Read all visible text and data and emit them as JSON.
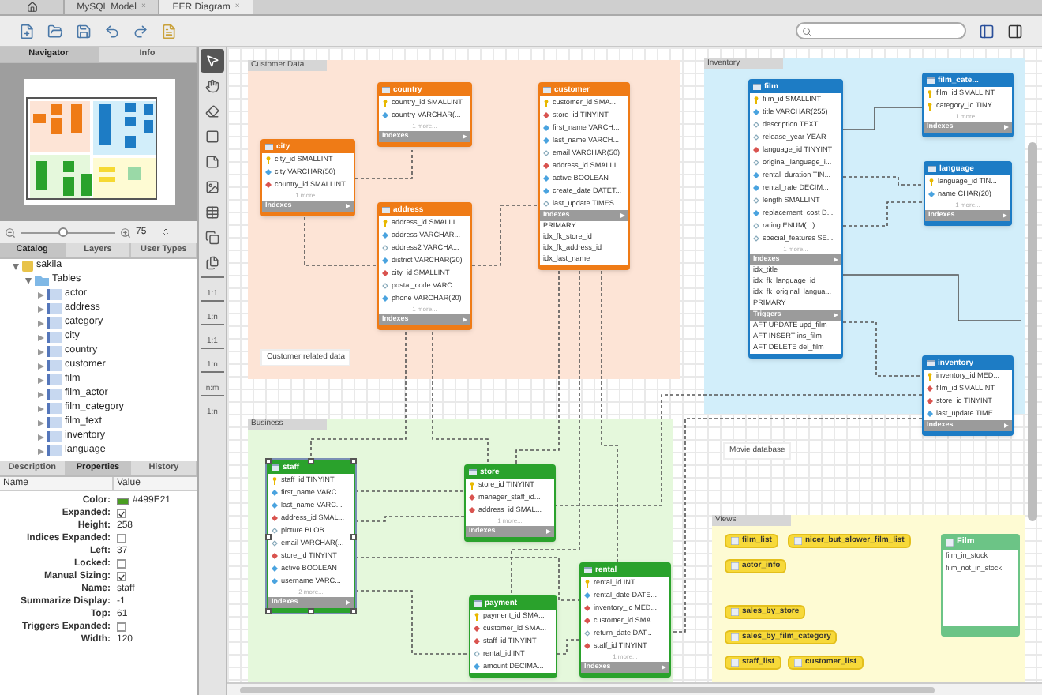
{
  "tabs": [
    {
      "label": "MySQL Model",
      "close": "×",
      "selected": false
    },
    {
      "label": "EER Diagram",
      "close": "×",
      "selected": true
    }
  ],
  "sidebar": {
    "top_tabs": [
      {
        "label": "Navigator",
        "selected": true
      },
      {
        "label": "Info",
        "selected": false
      }
    ],
    "zoom": {
      "level": 0.45,
      "value": "75"
    },
    "catalog_tabs": [
      {
        "label": "Catalog",
        "selected": true
      },
      {
        "label": "Layers",
        "selected": false
      },
      {
        "label": "User Types",
        "selected": false
      }
    ],
    "tree": [
      {
        "label": "sakila",
        "kind": "schema",
        "expanded": true,
        "children": [
          {
            "label": "Tables",
            "kind": "folder",
            "expanded": true,
            "children": [
              {
                "label": "actor",
                "kind": "table",
                "expanded": false
              },
              {
                "label": "address",
                "kind": "table",
                "expanded": false
              },
              {
                "label": "category",
                "kind": "table",
                "expanded": false
              },
              {
                "label": "city",
                "kind": "table",
                "expanded": false
              },
              {
                "label": "country",
                "kind": "table",
                "expanded": false
              },
              {
                "label": "customer",
                "kind": "table",
                "expanded": false
              },
              {
                "label": "film",
                "kind": "table",
                "expanded": false
              },
              {
                "label": "film_actor",
                "kind": "table",
                "expanded": false
              },
              {
                "label": "film_category",
                "kind": "table",
                "expanded": false
              },
              {
                "label": "film_text",
                "kind": "table",
                "expanded": false
              },
              {
                "label": "inventory",
                "kind": "table",
                "expanded": false
              },
              {
                "label": "language",
                "kind": "table",
                "expanded": false
              }
            ]
          }
        ]
      }
    ],
    "bottom_tabs": [
      {
        "label": "Description",
        "selected": false
      },
      {
        "label": "Properties",
        "selected": true
      },
      {
        "label": "History",
        "selected": false
      }
    ],
    "properties": {
      "columns": [
        "Name",
        "Value"
      ],
      "rows": [
        {
          "name": "Color:",
          "kind": "color",
          "value": "#499E21",
          "color": "#499e21"
        },
        {
          "name": "Expanded:",
          "kind": "check",
          "checked": true
        },
        {
          "name": "Height:",
          "kind": "text",
          "value": "258"
        },
        {
          "name": "Indices Expanded:",
          "kind": "check",
          "checked": false
        },
        {
          "name": "Left:",
          "kind": "text",
          "value": "37"
        },
        {
          "name": "Locked:",
          "kind": "check",
          "checked": false
        },
        {
          "name": "Manual Sizing:",
          "kind": "check",
          "checked": true
        },
        {
          "name": "Name:",
          "kind": "text",
          "value": "staff"
        },
        {
          "name": "Summarize Display:",
          "kind": "text",
          "value": "-1"
        },
        {
          "name": "Top:",
          "kind": "text",
          "value": "61"
        },
        {
          "name": "Triggers Expanded:",
          "kind": "check",
          "checked": false
        },
        {
          "name": "Width:",
          "kind": "text",
          "value": "120"
        }
      ]
    }
  },
  "tools": [
    {
      "kind": "pointer",
      "selected": true
    },
    {
      "kind": "hand",
      "selected": false
    },
    {
      "kind": "eraser",
      "selected": false
    },
    {
      "kind": "layer",
      "selected": false
    },
    {
      "kind": "note",
      "selected": false
    },
    {
      "kind": "image",
      "selected": false
    },
    {
      "kind": "table",
      "selected": false
    },
    {
      "kind": "view",
      "selected": false
    },
    {
      "kind": "routines",
      "selected": false
    },
    {
      "kind": "relation",
      "label": "1:1",
      "selected": false
    },
    {
      "kind": "relation",
      "label": "1:n",
      "selected": false
    },
    {
      "kind": "relation",
      "label": "1:1",
      "selected": false
    },
    {
      "kind": "relation",
      "label": "1:n",
      "selected": false
    },
    {
      "kind": "relation",
      "label": "n:m",
      "selected": false
    },
    {
      "kind": "relation",
      "label": "1:n",
      "selected": false
    }
  ],
  "layers": [
    {
      "title": "Customer Data",
      "color": "#fde4d6"
    },
    {
      "title": "Inventory",
      "color": "#d2eefa"
    },
    {
      "title": "Business",
      "color": "#e5f8dc"
    },
    {
      "title": "Views",
      "color": "#fefbd3"
    }
  ],
  "notes": [
    {
      "text": "Customer related data"
    },
    {
      "text": "Movie database"
    }
  ],
  "tables": [
    {
      "name": "city",
      "color": "#ef7b16",
      "selected": false,
      "columns": [
        {
          "text": "city_id SMALLINT",
          "kind": "pk"
        },
        {
          "text": "city VARCHAR(50)",
          "kind": "col"
        },
        {
          "text": "country_id SMALLINT",
          "kind": "fk"
        }
      ],
      "more": "1 more...",
      "footer": "Indexes"
    },
    {
      "name": "country",
      "color": "#ef7b16",
      "selected": false,
      "columns": [
        {
          "text": "country_id SMALLINT",
          "kind": "pk"
        },
        {
          "text": "country VARCHAR(...",
          "kind": "col"
        }
      ],
      "more": "1 more...",
      "footer": "Indexes"
    },
    {
      "name": "address",
      "color": "#ef7b16",
      "selected": false,
      "columns": [
        {
          "text": "address_id SMALLI...",
          "kind": "pk"
        },
        {
          "text": "address VARCHAR...",
          "kind": "col"
        },
        {
          "text": "address2 VARCHA...",
          "kind": "opt"
        },
        {
          "text": "district VARCHAR(20)",
          "kind": "col"
        },
        {
          "text": "city_id SMALLINT",
          "kind": "fk"
        },
        {
          "text": "postal_code VARC...",
          "kind": "opt"
        },
        {
          "text": "phone VARCHAR(20)",
          "kind": "col"
        }
      ],
      "more": "1 more...",
      "footer": "Indexes"
    },
    {
      "name": "customer",
      "color": "#ef7b16",
      "selected": false,
      "columns": [
        {
          "text": "customer_id SMA...",
          "kind": "pk"
        },
        {
          "text": "store_id TINYINT",
          "kind": "fk"
        },
        {
          "text": "first_name VARCH...",
          "kind": "col"
        },
        {
          "text": "last_name VARCH...",
          "kind": "col"
        },
        {
          "text": "email VARCHAR(50)",
          "kind": "opt"
        },
        {
          "text": "address_id SMALLI...",
          "kind": "fk"
        },
        {
          "text": "active BOOLEAN",
          "kind": "col"
        },
        {
          "text": "create_date DATET...",
          "kind": "col"
        },
        {
          "text": "last_update TIMES...",
          "kind": "opt"
        }
      ],
      "footer": "Indexes",
      "indexes": [
        "PRIMARY",
        "idx_fk_store_id",
        "idx_fk_address_id",
        "idx_last_name"
      ]
    },
    {
      "name": "film",
      "color": "#1d7cc5",
      "selected": false,
      "columns": [
        {
          "text": "film_id SMALLINT",
          "kind": "pk"
        },
        {
          "text": "title VARCHAR(255)",
          "kind": "col"
        },
        {
          "text": "description TEXT",
          "kind": "opt"
        },
        {
          "text": "release_year YEAR",
          "kind": "opt"
        },
        {
          "text": "language_id TINYINT",
          "kind": "fk"
        },
        {
          "text": "original_language_i...",
          "kind": "opt"
        },
        {
          "text": "rental_duration TIN...",
          "kind": "col"
        },
        {
          "text": "rental_rate DECIM...",
          "kind": "col"
        },
        {
          "text": "length SMALLINT",
          "kind": "opt"
        },
        {
          "text": "replacement_cost D...",
          "kind": "col"
        },
        {
          "text": "rating ENUM(...)",
          "kind": "opt"
        },
        {
          "text": "special_features SE...",
          "kind": "opt"
        }
      ],
      "more": "1 more...",
      "footer": "Indexes",
      "indexes": [
        "idx_title",
        "idx_fk_language_id",
        "idx_fk_original_langua...",
        "PRIMARY"
      ],
      "triggers_footer": "Triggers",
      "triggers": [
        "AFT UPDATE upd_film",
        "AFT INSERT ins_film",
        "AFT DELETE del_film"
      ]
    },
    {
      "name": "film_cate...",
      "color": "#1d7cc5",
      "selected": false,
      "columns": [
        {
          "text": "film_id SMALLINT",
          "kind": "pk"
        },
        {
          "text": "category_id TINY...",
          "kind": "pk"
        }
      ],
      "more": "1 more...",
      "footer": "Indexes"
    },
    {
      "name": "language",
      "color": "#1d7cc5",
      "selected": false,
      "columns": [
        {
          "text": "language_id TIN...",
          "kind": "pk"
        },
        {
          "text": "name CHAR(20)",
          "kind": "col"
        }
      ],
      "more": "1 more...",
      "footer": "Indexes"
    },
    {
      "name": "inventory",
      "color": "#1d7cc5",
      "selected": false,
      "columns": [
        {
          "text": "inventory_id MED...",
          "kind": "pk"
        },
        {
          "text": "film_id SMALLINT",
          "kind": "fk"
        },
        {
          "text": "store_id TINYINT",
          "kind": "fk"
        },
        {
          "text": "last_update TIME...",
          "kind": "col"
        }
      ],
      "footer": "Indexes"
    },
    {
      "name": "staff",
      "color": "#2aa22c",
      "selected": true,
      "columns": [
        {
          "text": "staff_id TINYINT",
          "kind": "pk"
        },
        {
          "text": "first_name VARC...",
          "kind": "col"
        },
        {
          "text": "last_name VARC...",
          "kind": "col"
        },
        {
          "text": "address_id SMAL...",
          "kind": "fk"
        },
        {
          "text": "picture BLOB",
          "kind": "opt"
        },
        {
          "text": "email VARCHAR(...",
          "kind": "opt"
        },
        {
          "text": "store_id TINYINT",
          "kind": "fk"
        },
        {
          "text": "active BOOLEAN",
          "kind": "col"
        },
        {
          "text": "username VARC...",
          "kind": "col"
        }
      ],
      "more": "2 more...",
      "footer": "Indexes"
    },
    {
      "name": "store",
      "color": "#2aa22c",
      "selected": false,
      "columns": [
        {
          "text": "store_id TINYINT",
          "kind": "pk"
        },
        {
          "text": "manager_staff_id...",
          "kind": "fk"
        },
        {
          "text": "address_id SMAL...",
          "kind": "fk"
        }
      ],
      "more": "1 more...",
      "footer": "Indexes"
    },
    {
      "name": "payment",
      "color": "#2aa22c",
      "selected": false,
      "columns": [
        {
          "text": "payment_id SMA...",
          "kind": "pk"
        },
        {
          "text": "customer_id SMA...",
          "kind": "fk"
        },
        {
          "text": "staff_id TINYINT",
          "kind": "fk"
        },
        {
          "text": "rental_id INT",
          "kind": "opt"
        },
        {
          "text": "amount DECIMA...",
          "kind": "col"
        }
      ]
    },
    {
      "name": "rental",
      "color": "#2aa22c",
      "selected": false,
      "columns": [
        {
          "text": "rental_id INT",
          "kind": "pk"
        },
        {
          "text": "rental_date DATE...",
          "kind": "col"
        },
        {
          "text": "inventory_id MED...",
          "kind": "fk"
        },
        {
          "text": "customer_id SMA...",
          "kind": "fk"
        },
        {
          "text": "return_date DAT...",
          "kind": "opt"
        },
        {
          "text": "staff_id TINYINT",
          "kind": "fk"
        }
      ],
      "more": "1 more...",
      "footer": "Indexes"
    }
  ],
  "views": [
    {
      "name": "film_list"
    },
    {
      "name": "nicer_but_slower_film_list"
    },
    {
      "name": "actor_info"
    },
    {
      "name": "sales_by_store"
    },
    {
      "name": "sales_by_film_category"
    },
    {
      "name": "staff_list"
    },
    {
      "name": "customer_list"
    }
  ],
  "routine_group": {
    "title": "Film",
    "items": [
      "film_in_stock",
      "film_not_in_stock"
    ]
  }
}
